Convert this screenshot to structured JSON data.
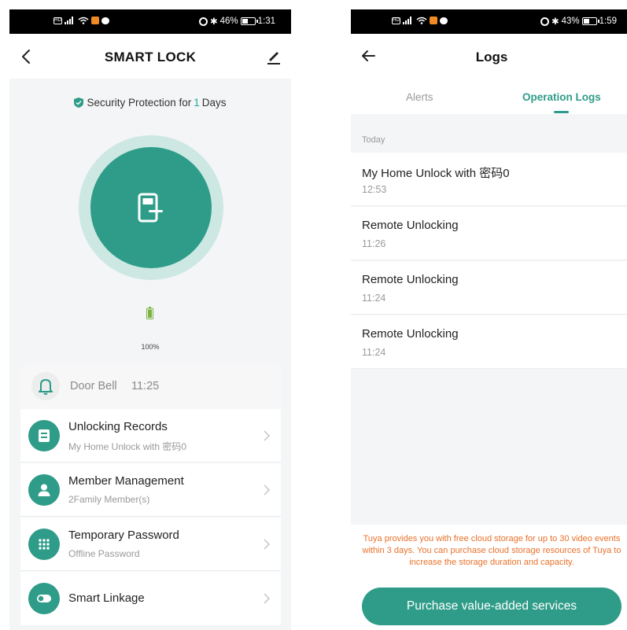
{
  "left_screen": {
    "statusbar": {
      "battery": "46%",
      "time": "1:31"
    },
    "header": {
      "title": "SMART LOCK"
    },
    "security": {
      "prefix": "Security Protection for",
      "days": "1",
      "suffix": "Days"
    },
    "battery": {
      "percent_label": "100%",
      "level": 1.0
    },
    "doorbell": {
      "label": "Door Bell",
      "time": "11:25"
    },
    "menu": [
      {
        "title": "Unlocking Records",
        "subtitle": "My Home Unlock with 密码0",
        "icon": "record-icon"
      },
      {
        "title": "Member Management",
        "subtitle": "2Family Member(s)",
        "icon": "person-icon"
      },
      {
        "title": "Temporary Password",
        "subtitle": "Offline Password",
        "icon": "keypad-icon"
      },
      {
        "title": "Smart Linkage",
        "subtitle": "",
        "icon": "toggle-icon"
      }
    ]
  },
  "right_screen": {
    "statusbar": {
      "battery": "43%",
      "time": "1:59"
    },
    "header": {
      "title": "Logs"
    },
    "tabs": [
      {
        "label": "Alerts",
        "active": false
      },
      {
        "label": "Operation Logs",
        "active": true
      }
    ],
    "section": "Today",
    "logs": [
      {
        "title": "My Home Unlock with 密码0",
        "time": "12:53"
      },
      {
        "title": "Remote Unlocking",
        "time": "11:26"
      },
      {
        "title": "Remote Unlocking",
        "time": "11:24"
      },
      {
        "title": "Remote Unlocking",
        "time": "11:24"
      }
    ],
    "storage_note": "Tuya provides you with free cloud storage for up to 30 video events within 3 days. You can purchase cloud storage resources of Tuya to increase the storage duration and capacity.",
    "purchase_button": "Purchase value-added services"
  },
  "colors": {
    "accent": "#2e9c88",
    "accent_light": "#cde8e3",
    "warning": "#e8712a",
    "background": "#f4f5f7"
  }
}
